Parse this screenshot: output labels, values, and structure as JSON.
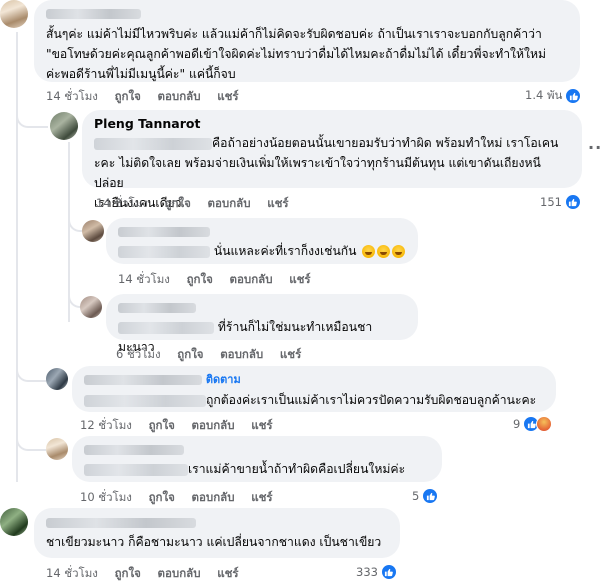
{
  "comment1": {
    "text_line1": "สั้นๆค่ะ แม่ค้าไม่มีไหวพริบค่ะ แล้วแม่ค้าก็ไม่คิดจะรับผิดชอบค่ะ ถ้าเป็นเราเราจะบอกกับลูกค้าว่า",
    "text_line2": "\"ขอโทษด้วยค่ะคุณลูกค้าพอดีเข้าใจผิดค่ะไม่ทราบว่าดื่มได้ไหมคะถ้าดื่มไม่ได้ เดี๋ยวพี่จะทำให้ใหม่",
    "text_line3": "ค่ะพอดีร้านพี่ไม่มีเมนูนี้ค่ะ\" แค่นี้ก็จบ",
    "time": "14 ชั่วโมง",
    "like": "ถูกใจ",
    "reply": "ตอบกลับ",
    "share": "แชร์",
    "reactions": "1.4 พัน"
  },
  "reply1": {
    "author": "Pleng Tannarot",
    "text_line1": "คือถ้าอย่างน้อยตอนนั้นเขายอมรับว่าทำผิด พร้อมทำใหม่ เราโอเคน",
    "text_line2": "ะคะ ไม่ติดใจเลย พร้อมจ่ายเงินเพิ่มให้เพราะเข้าใจว่าทุกร้านมีต้นทุน แต่เขาดันเถียงหนี ปล่อย",
    "text_line3": "เรายืนงงคนเดียว",
    "time": "14 ชั่วโมง",
    "like": "ถูกใจ",
    "reply": "ตอบกลับ",
    "share": "แชร์",
    "reactions": "151"
  },
  "reply2": {
    "text": "นั่นแหละค่ะที่เราก็งงเช่นกัน",
    "time": "14 ชั่วโมง",
    "like": "ถูกใจ",
    "reply": "ตอบกลับ",
    "share": "แชร์"
  },
  "reply3": {
    "text": "ที่ร้านก็ไม่ใช่มนะทำเหมือนชามะนาว",
    "time": "6 ชั่วโมง",
    "like": "ถูกใจ",
    "reply": "ตอบกลับ",
    "share": "แชร์"
  },
  "reply4": {
    "follow": "ติดตาม",
    "text": "ถูกต้องค่ะเราเป็นแม่ค้าเราไม่ควรปัดความรับผิดชอบลูกค้านะคะ",
    "time": "12 ชั่วโมง",
    "like": "ถูกใจ",
    "reply": "ตอบกลับ",
    "share": "แชร์",
    "reactions": "9"
  },
  "reply5": {
    "text": "เราแม่ค้าขายน้ำถ้าทำผิดคือเปลี่ยนใหม่ค่ะ",
    "time": "10 ชั่วโมง",
    "like": "ถูกใจ",
    "reply": "ตอบกลับ",
    "share": "แชร์",
    "reactions": "5"
  },
  "comment2": {
    "text": "ชาเขียวมะนาว ก็คือชามะนาว แค่เปลี่ยนจากชาแดง เป็นชาเขียว",
    "time": "14 ชั่วโมง",
    "like": "ถูกใจ",
    "reply": "ตอบกลับ",
    "share": "แชร์",
    "reactions": "333"
  },
  "icons": {
    "like": "like-icon",
    "angry": "angry-icon",
    "more": "more-icon",
    "laugh": "laughing-emoji-icon"
  },
  "colors": {
    "bubble": "#f0f2f5",
    "meta_text": "#65676b",
    "like_blue": "#1877f2"
  }
}
